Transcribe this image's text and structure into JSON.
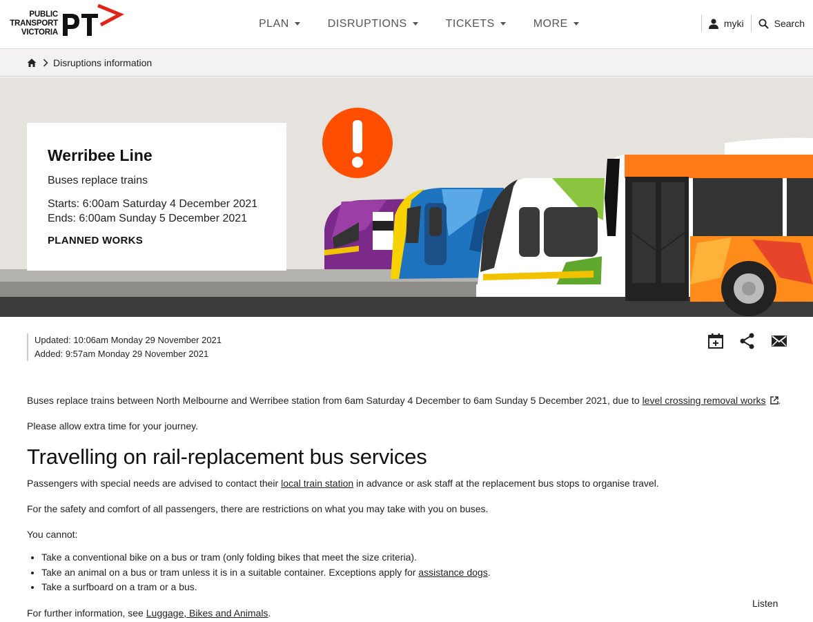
{
  "header": {
    "logo": {
      "line1": "PUBLIC",
      "line2": "TRANSPORT",
      "line3": "VICTORIA",
      "mark": "PT"
    },
    "nav": [
      {
        "label": "PLAN"
      },
      {
        "label": "DISRUPTIONS"
      },
      {
        "label": "TICKETS"
      },
      {
        "label": "MORE"
      }
    ],
    "myki_label": "myki",
    "search_label": "Search"
  },
  "breadcrumb": {
    "home_icon": "home-icon",
    "current": "Disruptions information"
  },
  "hero": {
    "title": "Werribee Line",
    "subtitle": "Buses replace trains",
    "starts": "Starts: 6:00am Saturday 4 December 2021",
    "ends": "Ends: 6:00am Sunday 5 December 2021",
    "type": "PLANNED WORKS",
    "alert_icon": "exclamation-icon"
  },
  "meta": {
    "updated": "Updated: 10:06am Monday 29 November 2021",
    "added": "Added: 9:57am Monday 29 November 2021"
  },
  "actions": [
    "calendar-add-icon",
    "share-icon",
    "email-icon"
  ],
  "content": {
    "intro_before": "Buses replace trains between North Melbourne and Werribee station from 6am Saturday 4 December to 6am Sunday 5 December  2021,  due to ",
    "intro_link": "level crossing removal works",
    "intro_after": ".",
    "allow": "Please allow extra time for your journey.",
    "heading": "Travelling on rail-replacement bus services",
    "special_before": "Passengers with special needs are advised to contact their ",
    "special_link": "local train station",
    "special_after": " in advance or ask staff at the replacement bus stops to organise travel.",
    "safety": "For the safety and comfort of all passengers, there are restrictions on what you may take with you on buses.",
    "cannot": "You cannot:",
    "list": {
      "item1": "Take a conventional bike on a bus or tram (only folding bikes that meet the size criteria).",
      "item2_before": "Take an animal on a bus or tram unless it is in a suitable container. Exceptions apply for ",
      "item2_link": "assistance dogs",
      "item2_after": ".",
      "item3": "Take a surfboard on a tram or a bus."
    },
    "further_before": "For further information, see ",
    "further_link": "Luggage, Bikes and Animals",
    "further_after": "."
  },
  "listen_label": "Listen",
  "colors": {
    "alert": "#ff4e00",
    "brand_red": "#e2231a",
    "hero_bg": "#e6e3de"
  }
}
